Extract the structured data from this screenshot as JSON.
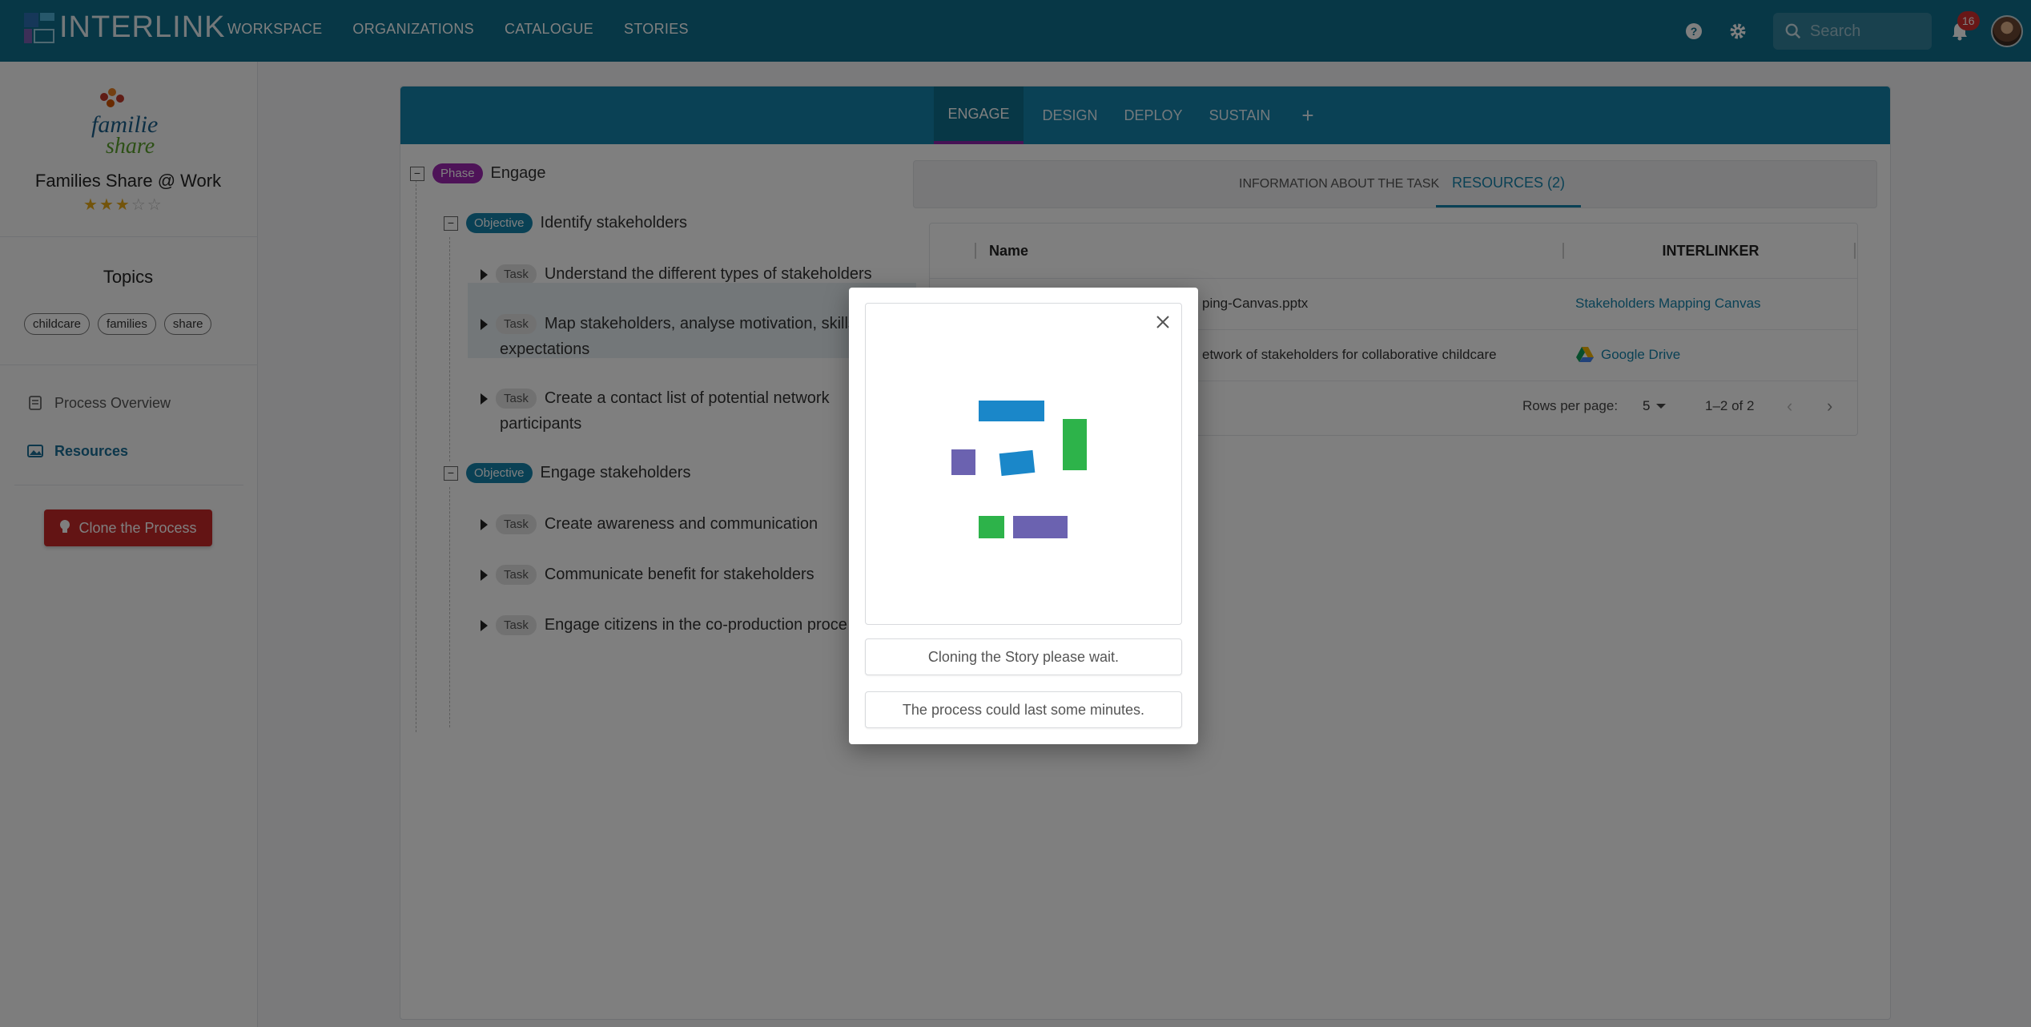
{
  "app": {
    "logo_text": "INTERLINK",
    "nav": [
      "WORKSPACE",
      "ORGANIZATIONS",
      "CATALOGUE",
      "STORIES"
    ],
    "search_placeholder": "Search",
    "notifications_count": "16",
    "icons": [
      "help-icon",
      "settings-icon",
      "search-icon",
      "bell-icon"
    ]
  },
  "sidebar": {
    "brand_logo_text": "familie share",
    "title": "Families Share @ Work",
    "rating": 3,
    "rating_max": 5,
    "topics_title": "Topics",
    "topics": [
      "childcare",
      "families",
      "share"
    ],
    "links": [
      {
        "label": "Process Overview",
        "icon": "process-icon",
        "active": false
      },
      {
        "label": "Resources",
        "icon": "resources-icon",
        "active": true
      }
    ],
    "clone_button": "Clone the Process"
  },
  "tabs": [
    "ENGAGE",
    "DESIGN",
    "DEPLOY",
    "SUSTAIN",
    "+"
  ],
  "active_tab": "ENGAGE",
  "tree": {
    "phase": {
      "tag": "Phase",
      "label": "Engage"
    },
    "objectives": [
      {
        "tag": "Objective",
        "label": "Identify stakeholders",
        "tasks": [
          {
            "tag": "Task",
            "label": "Understand the different types of stakeholders"
          },
          {
            "tag": "Task",
            "label_line1": "Map stakeholders, analyse motivation, skills,",
            "label_line2": "expectations"
          },
          {
            "tag": "Task",
            "label_line1": "Create a contact list of potential network",
            "label_line2": "participants"
          }
        ]
      },
      {
        "tag": "Objective",
        "label": "Engage stakeholders",
        "tasks": [
          {
            "tag": "Task",
            "label": "Create awareness and communication"
          },
          {
            "tag": "Task",
            "label": "Communicate benefit for stakeholders"
          },
          {
            "tag": "Task",
            "label": "Engage citizens in the co-production proce"
          }
        ]
      }
    ]
  },
  "subtabs": {
    "info": "INFORMATION ABOUT THE TASK",
    "resources": "RESOURCES (2)"
  },
  "table": {
    "headers": {
      "name": "Name",
      "interlinker": "INTERLINKER"
    },
    "rows": [
      {
        "name": "ping-Canvas.pptx",
        "interlinker": "Stakeholders Mapping Canvas"
      },
      {
        "name": "etwork of stakeholders for collaborative childcare",
        "interlinker": "Google Drive"
      }
    ],
    "rows_per_page_label": "Rows per page:",
    "rows_per_page": "5",
    "pagination": "1–2 of 2"
  },
  "modal": {
    "message1": "Cloning the Story please wait.",
    "message2": "The process could last some minutes.",
    "colors": {
      "blue": "#1a87c9",
      "green": "#2db34a",
      "purple": "#6b62b0"
    }
  },
  "colors": {
    "topbar": "#0f6e8c",
    "tabbar": "#1583ab",
    "phase": "#9c27b0",
    "clone": "#c62828"
  }
}
